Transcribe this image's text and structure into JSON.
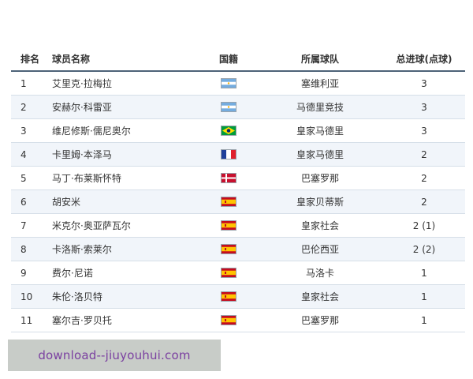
{
  "headers": {
    "rank": "排名",
    "name": "球员名称",
    "nationality": "国籍",
    "club": "所属球队",
    "goals": "总进球(点球)"
  },
  "rows": [
    {
      "rank": "1",
      "name": "艾里克·拉梅拉",
      "flag": "argentina-flag-icon",
      "club": "塞维利亚",
      "goals": "3"
    },
    {
      "rank": "2",
      "name": "安赫尔·科雷亚",
      "flag": "argentina-flag-icon",
      "club": "马德里竞技",
      "goals": "3"
    },
    {
      "rank": "3",
      "name": "维尼修斯·儒尼奥尔",
      "flag": "brazil-flag-icon",
      "club": "皇家马德里",
      "goals": "3"
    },
    {
      "rank": "4",
      "name": "卡里姆·本泽马",
      "flag": "france-flag-icon",
      "club": "皇家马德里",
      "goals": "2"
    },
    {
      "rank": "5",
      "name": "马丁·布莱斯怀特",
      "flag": "denmark-flag-icon",
      "club": "巴塞罗那",
      "goals": "2"
    },
    {
      "rank": "6",
      "name": "胡安米",
      "flag": "spain-flag-icon",
      "club": "皇家贝蒂斯",
      "goals": "2"
    },
    {
      "rank": "7",
      "name": "米克尔·奥亚萨瓦尔",
      "flag": "spain-flag-icon",
      "club": "皇家社会",
      "goals": "2 (1)"
    },
    {
      "rank": "8",
      "name": "卡洛斯·索莱尔",
      "flag": "spain-flag-icon",
      "club": "巴伦西亚",
      "goals": "2 (2)"
    },
    {
      "rank": "9",
      "name": "费尔·尼诺",
      "flag": "spain-flag-icon",
      "club": "马洛卡",
      "goals": "1"
    },
    {
      "rank": "10",
      "name": "朱伦·洛贝特",
      "flag": "spain-flag-icon",
      "club": "皇家社会",
      "goals": "1"
    },
    {
      "rank": "11",
      "name": "塞尔吉·罗贝托",
      "flag": "spain-flag-icon",
      "club": "巴塞罗那",
      "goals": "1"
    }
  ],
  "watermark": "download--jiuyouhui.com",
  "colors": {
    "header_rule": "#4d6378",
    "row_alt": "#f1f5fa",
    "row_rule": "#d6dfe8",
    "watermark_bg": "#c8ccc8",
    "watermark_text": "#7a3fa0"
  }
}
